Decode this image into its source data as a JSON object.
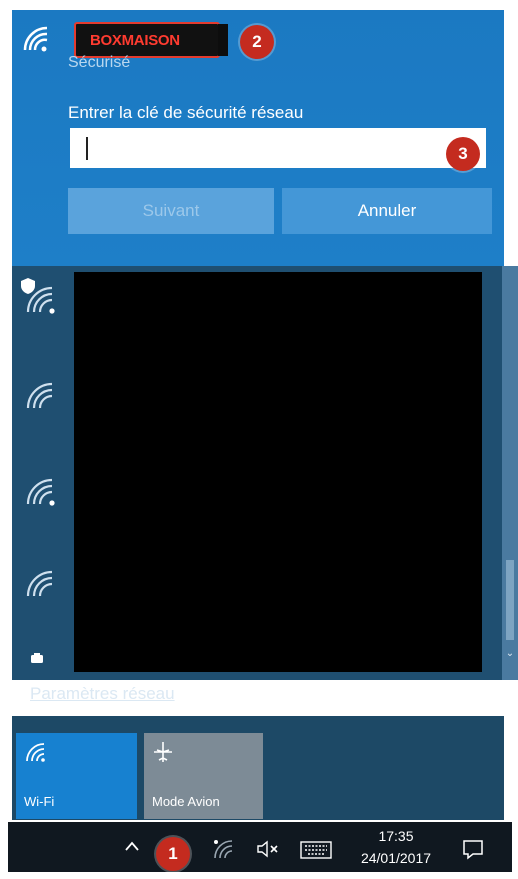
{
  "selected_network": {
    "ssid": "BOXMAISON",
    "status": "Sécurisé",
    "security_prompt": "Entrer la clé de sécurité réseau",
    "key_value": "",
    "next_label": "Suivant",
    "cancel_label": "Annuler",
    "icon": "wifi-signal-icon"
  },
  "network_list": {
    "icons": [
      "wifi-secured-icon",
      "wifi-signal-icon",
      "wifi-signal-icon",
      "wifi-signal-icon"
    ],
    "redacted": true
  },
  "settings_link": "Paramètres réseau",
  "quick_actions": [
    {
      "label": "Wi-Fi",
      "icon": "wifi-icon",
      "active": true
    },
    {
      "label": "Mode Avion",
      "icon": "airplane-icon",
      "active": false
    }
  ],
  "taskbar": {
    "time": "17:35",
    "date": "24/01/2017",
    "icons": [
      "chevron-up-icon",
      "wifi-icon",
      "volume-muted-icon",
      "keyboard-icon",
      "notification-icon"
    ]
  },
  "step_markers": [
    "1",
    "2",
    "3"
  ],
  "colors": {
    "panel_blue": "#1b79c2",
    "list_dark": "#1f4f71",
    "tile_active": "#1781d0",
    "tile_inactive": "#7d8b96",
    "taskbar": "#101820",
    "marker_red": "#c42b1f"
  }
}
